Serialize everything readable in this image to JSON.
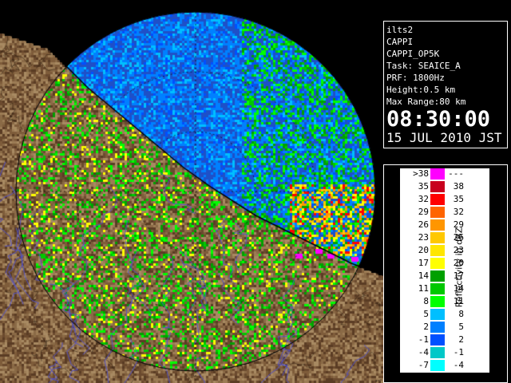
{
  "info": {
    "station": "ilts2",
    "product": "CAPPI",
    "product_id": "CAPPI_OP5K",
    "task": "Task: SEAICE_A",
    "prf": "PRF: 1800Hz",
    "height": "Height:0.5 km",
    "max_range": "Max Range:80 km",
    "time": "08:30:00",
    "date": "15 JUL 2010 JST"
  },
  "legend": {
    "unit_label": "Reflectivity in dBZ",
    "rows": [
      {
        "lo": ">38",
        "hi": "---",
        "color": "#ff00ff"
      },
      {
        "lo": "35",
        "hi": "38",
        "color": "#c8001e"
      },
      {
        "lo": "32",
        "hi": "35",
        "color": "#ff0000"
      },
      {
        "lo": "29",
        "hi": "32",
        "color": "#ff6400"
      },
      {
        "lo": "26",
        "hi": "29",
        "color": "#ff9600"
      },
      {
        "lo": "23",
        "hi": "26",
        "color": "#ffc800"
      },
      {
        "lo": "20",
        "hi": "23",
        "color": "#ffe600"
      },
      {
        "lo": "17",
        "hi": "20",
        "color": "#ffff00"
      },
      {
        "lo": "14",
        "hi": "17",
        "color": "#00a000"
      },
      {
        "lo": "11",
        "hi": "14",
        "color": "#00c800"
      },
      {
        "lo": "8",
        "hi": "11",
        "color": "#00ff00"
      },
      {
        "lo": "5",
        "hi": "8",
        "color": "#00bfff"
      },
      {
        "lo": "2",
        "hi": "5",
        "color": "#0080ff"
      },
      {
        "lo": "-1",
        "hi": "2",
        "color": "#0050ff"
      },
      {
        "lo": "-4",
        "hi": "-1",
        "color": "#00c8c8"
      },
      {
        "lo": "-7",
        "hi": "-4",
        "color": "#00ffff"
      }
    ]
  },
  "colors": {
    "sea_background": "#2864dc",
    "land_base": "#7a5a3c",
    "coast_line": "#000000",
    "river_lines": "#5050c8",
    "range_rings": "#000000"
  }
}
